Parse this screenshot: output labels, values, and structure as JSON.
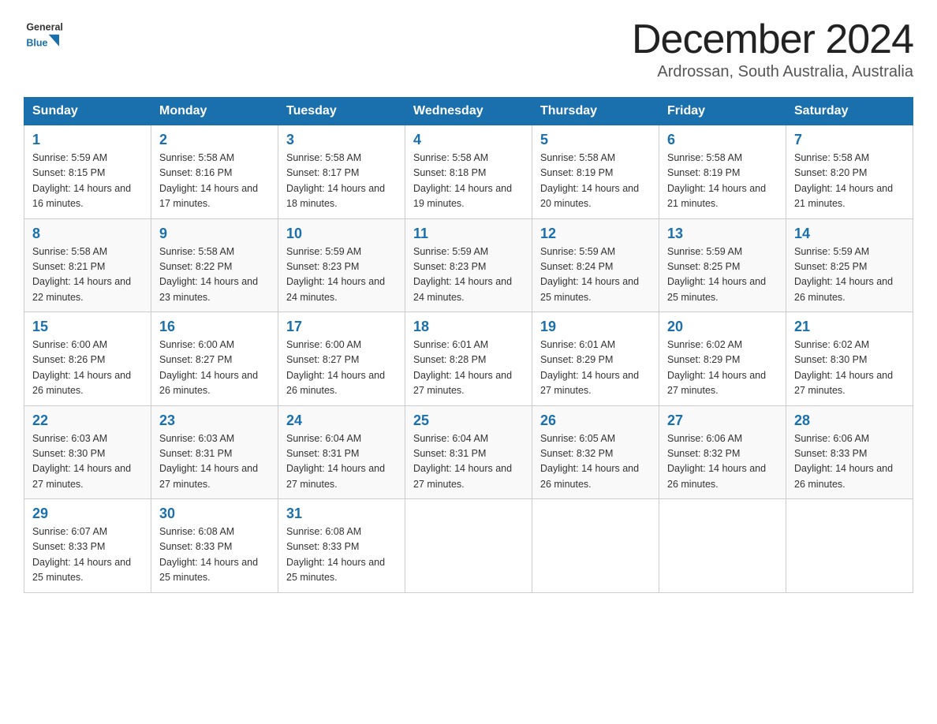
{
  "header": {
    "logo_text_general": "General",
    "logo_text_blue": "Blue",
    "month_title": "December 2024",
    "location": "Ardrossan, South Australia, Australia"
  },
  "columns": [
    "Sunday",
    "Monday",
    "Tuesday",
    "Wednesday",
    "Thursday",
    "Friday",
    "Saturday"
  ],
  "weeks": [
    [
      {
        "day": "1",
        "sunrise": "Sunrise: 5:59 AM",
        "sunset": "Sunset: 8:15 PM",
        "daylight": "Daylight: 14 hours and 16 minutes."
      },
      {
        "day": "2",
        "sunrise": "Sunrise: 5:58 AM",
        "sunset": "Sunset: 8:16 PM",
        "daylight": "Daylight: 14 hours and 17 minutes."
      },
      {
        "day": "3",
        "sunrise": "Sunrise: 5:58 AM",
        "sunset": "Sunset: 8:17 PM",
        "daylight": "Daylight: 14 hours and 18 minutes."
      },
      {
        "day": "4",
        "sunrise": "Sunrise: 5:58 AM",
        "sunset": "Sunset: 8:18 PM",
        "daylight": "Daylight: 14 hours and 19 minutes."
      },
      {
        "day": "5",
        "sunrise": "Sunrise: 5:58 AM",
        "sunset": "Sunset: 8:19 PM",
        "daylight": "Daylight: 14 hours and 20 minutes."
      },
      {
        "day": "6",
        "sunrise": "Sunrise: 5:58 AM",
        "sunset": "Sunset: 8:19 PM",
        "daylight": "Daylight: 14 hours and 21 minutes."
      },
      {
        "day": "7",
        "sunrise": "Sunrise: 5:58 AM",
        "sunset": "Sunset: 8:20 PM",
        "daylight": "Daylight: 14 hours and 21 minutes."
      }
    ],
    [
      {
        "day": "8",
        "sunrise": "Sunrise: 5:58 AM",
        "sunset": "Sunset: 8:21 PM",
        "daylight": "Daylight: 14 hours and 22 minutes."
      },
      {
        "day": "9",
        "sunrise": "Sunrise: 5:58 AM",
        "sunset": "Sunset: 8:22 PM",
        "daylight": "Daylight: 14 hours and 23 minutes."
      },
      {
        "day": "10",
        "sunrise": "Sunrise: 5:59 AM",
        "sunset": "Sunset: 8:23 PM",
        "daylight": "Daylight: 14 hours and 24 minutes."
      },
      {
        "day": "11",
        "sunrise": "Sunrise: 5:59 AM",
        "sunset": "Sunset: 8:23 PM",
        "daylight": "Daylight: 14 hours and 24 minutes."
      },
      {
        "day": "12",
        "sunrise": "Sunrise: 5:59 AM",
        "sunset": "Sunset: 8:24 PM",
        "daylight": "Daylight: 14 hours and 25 minutes."
      },
      {
        "day": "13",
        "sunrise": "Sunrise: 5:59 AM",
        "sunset": "Sunset: 8:25 PM",
        "daylight": "Daylight: 14 hours and 25 minutes."
      },
      {
        "day": "14",
        "sunrise": "Sunrise: 5:59 AM",
        "sunset": "Sunset: 8:25 PM",
        "daylight": "Daylight: 14 hours and 26 minutes."
      }
    ],
    [
      {
        "day": "15",
        "sunrise": "Sunrise: 6:00 AM",
        "sunset": "Sunset: 8:26 PM",
        "daylight": "Daylight: 14 hours and 26 minutes."
      },
      {
        "day": "16",
        "sunrise": "Sunrise: 6:00 AM",
        "sunset": "Sunset: 8:27 PM",
        "daylight": "Daylight: 14 hours and 26 minutes."
      },
      {
        "day": "17",
        "sunrise": "Sunrise: 6:00 AM",
        "sunset": "Sunset: 8:27 PM",
        "daylight": "Daylight: 14 hours and 26 minutes."
      },
      {
        "day": "18",
        "sunrise": "Sunrise: 6:01 AM",
        "sunset": "Sunset: 8:28 PM",
        "daylight": "Daylight: 14 hours and 27 minutes."
      },
      {
        "day": "19",
        "sunrise": "Sunrise: 6:01 AM",
        "sunset": "Sunset: 8:29 PM",
        "daylight": "Daylight: 14 hours and 27 minutes."
      },
      {
        "day": "20",
        "sunrise": "Sunrise: 6:02 AM",
        "sunset": "Sunset: 8:29 PM",
        "daylight": "Daylight: 14 hours and 27 minutes."
      },
      {
        "day": "21",
        "sunrise": "Sunrise: 6:02 AM",
        "sunset": "Sunset: 8:30 PM",
        "daylight": "Daylight: 14 hours and 27 minutes."
      }
    ],
    [
      {
        "day": "22",
        "sunrise": "Sunrise: 6:03 AM",
        "sunset": "Sunset: 8:30 PM",
        "daylight": "Daylight: 14 hours and 27 minutes."
      },
      {
        "day": "23",
        "sunrise": "Sunrise: 6:03 AM",
        "sunset": "Sunset: 8:31 PM",
        "daylight": "Daylight: 14 hours and 27 minutes."
      },
      {
        "day": "24",
        "sunrise": "Sunrise: 6:04 AM",
        "sunset": "Sunset: 8:31 PM",
        "daylight": "Daylight: 14 hours and 27 minutes."
      },
      {
        "day": "25",
        "sunrise": "Sunrise: 6:04 AM",
        "sunset": "Sunset: 8:31 PM",
        "daylight": "Daylight: 14 hours and 27 minutes."
      },
      {
        "day": "26",
        "sunrise": "Sunrise: 6:05 AM",
        "sunset": "Sunset: 8:32 PM",
        "daylight": "Daylight: 14 hours and 26 minutes."
      },
      {
        "day": "27",
        "sunrise": "Sunrise: 6:06 AM",
        "sunset": "Sunset: 8:32 PM",
        "daylight": "Daylight: 14 hours and 26 minutes."
      },
      {
        "day": "28",
        "sunrise": "Sunrise: 6:06 AM",
        "sunset": "Sunset: 8:33 PM",
        "daylight": "Daylight: 14 hours and 26 minutes."
      }
    ],
    [
      {
        "day": "29",
        "sunrise": "Sunrise: 6:07 AM",
        "sunset": "Sunset: 8:33 PM",
        "daylight": "Daylight: 14 hours and 25 minutes."
      },
      {
        "day": "30",
        "sunrise": "Sunrise: 6:08 AM",
        "sunset": "Sunset: 8:33 PM",
        "daylight": "Daylight: 14 hours and 25 minutes."
      },
      {
        "day": "31",
        "sunrise": "Sunrise: 6:08 AM",
        "sunset": "Sunset: 8:33 PM",
        "daylight": "Daylight: 14 hours and 25 minutes."
      },
      null,
      null,
      null,
      null
    ]
  ]
}
